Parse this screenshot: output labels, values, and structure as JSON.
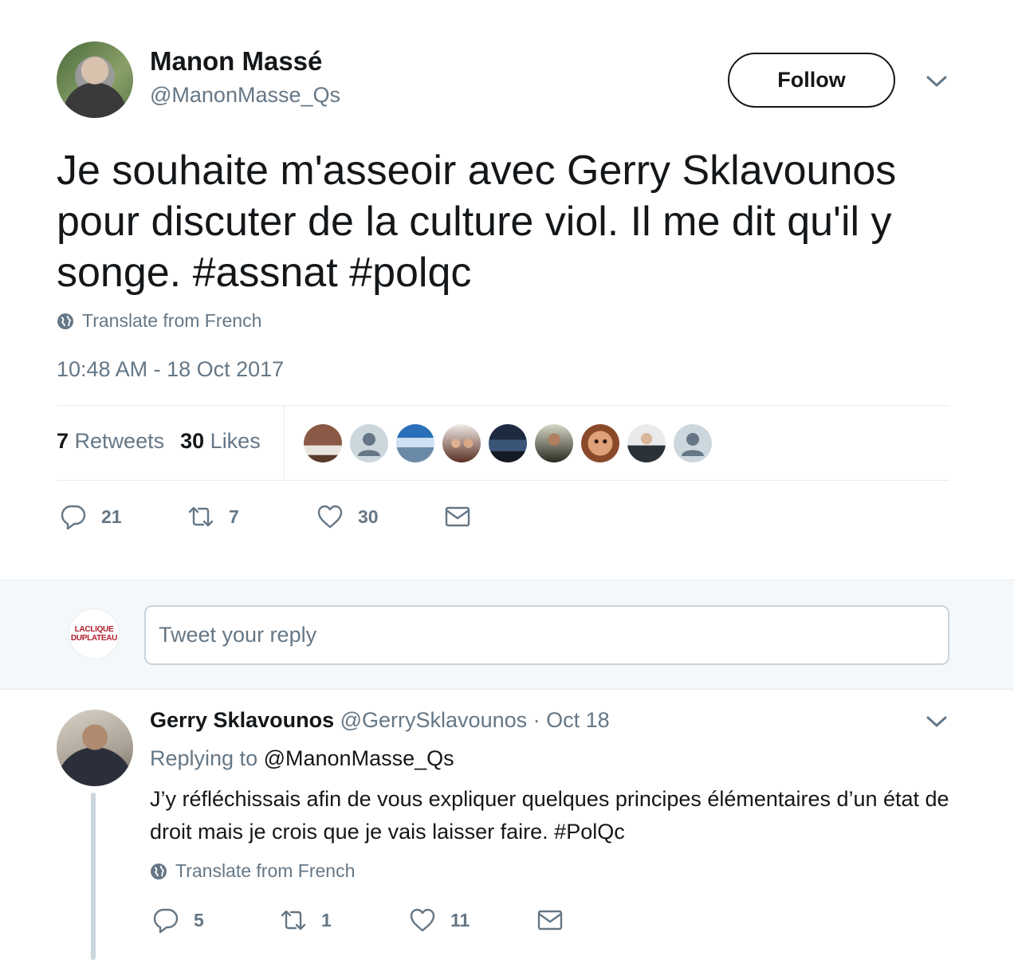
{
  "tweet": {
    "author_name": "Manon Massé",
    "author_handle": "@ManonMasse_Qs",
    "follow_label": "Follow",
    "text": "Je souhaite m'asseoir avec Gerry Sklavounos pour discuter de la culture viol. Il me dit qu'il y songe. #assnat #polqc",
    "translate_label": "Translate from French",
    "timestamp": "10:48 AM - 18 Oct 2017",
    "retweets_count": "7",
    "retweets_label": "Retweets",
    "likes_count": "30",
    "likes_label": "Likes",
    "actions": {
      "replies": "21",
      "retweets": "7",
      "likes": "30"
    }
  },
  "reply_box": {
    "placeholder": "Tweet your reply",
    "user_avatar_text_line1": "LACLIQUE",
    "user_avatar_text_line2": "DUPLATEAU"
  },
  "reply": {
    "author_name": "Gerry Sklavounos",
    "author_handle": "@GerrySklavounos",
    "date": "· Oct 18",
    "replying_prefix": "Replying to",
    "replying_to": "@ManonMasse_Qs",
    "text": "J’y réfléchissais afin de vous expliquer quelques principes élémentaires d’un état de droit mais je crois que je vais laisser faire. #PolQc",
    "translate_label": "Translate from French",
    "actions": {
      "replies": "5",
      "retweets": "1",
      "likes": "11"
    }
  },
  "colors": {
    "text": "#14171a",
    "secondary": "#657786",
    "border": "#e6ecf0",
    "reply_bg": "#f5f8fa"
  },
  "liker_avatars": [
    {
      "icon": "photo-avatar",
      "color": "#7a4a3a"
    },
    {
      "icon": "default-avatar",
      "color": "#ccd6dd"
    },
    {
      "icon": "photo-avatar",
      "color": "#2a6fb8"
    },
    {
      "icon": "photo-avatar",
      "color": "#6b3b2e"
    },
    {
      "icon": "photo-avatar",
      "color": "#2b3a55"
    },
    {
      "icon": "photo-avatar",
      "color": "#3a3a2a"
    },
    {
      "icon": "photo-avatar",
      "color": "#c98a5a"
    },
    {
      "icon": "photo-avatar",
      "color": "#6a7a7a"
    },
    {
      "icon": "default-avatar",
      "color": "#ccd6dd"
    }
  ]
}
